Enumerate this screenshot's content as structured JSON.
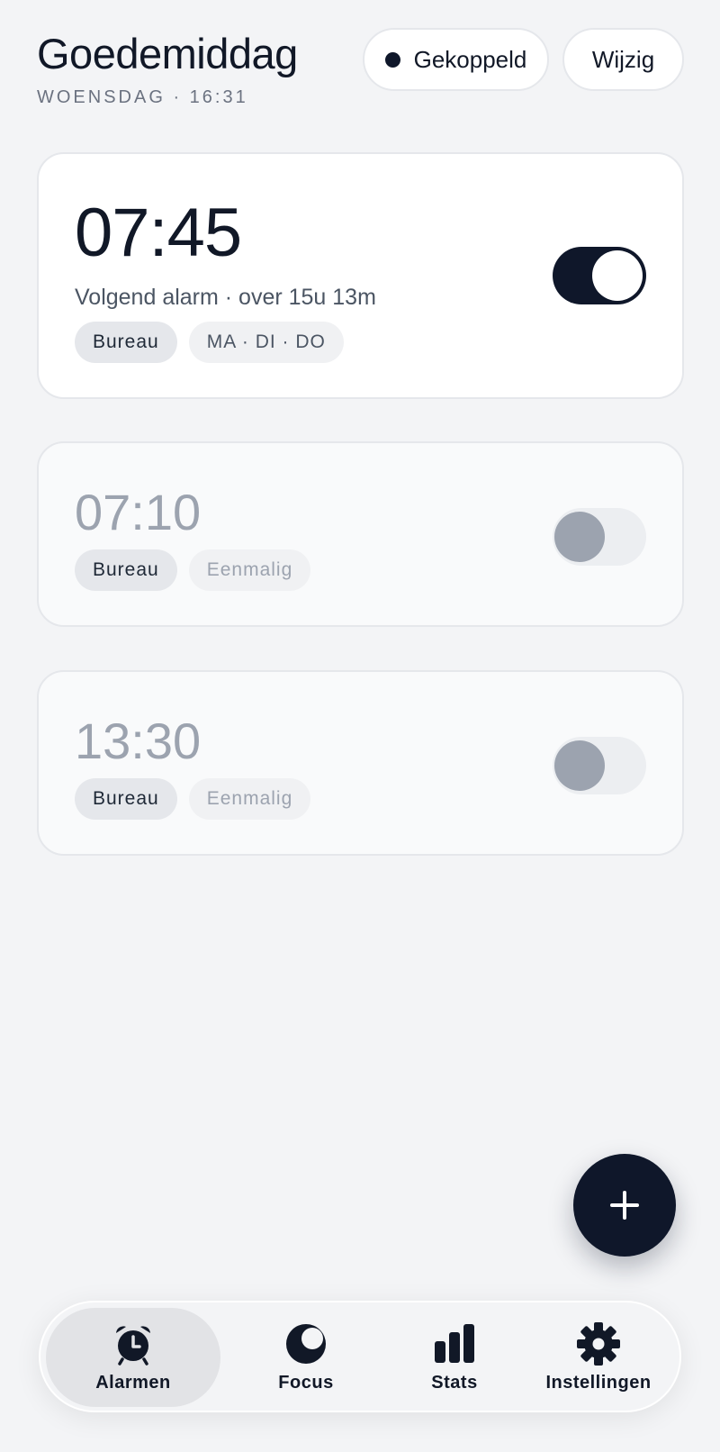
{
  "header": {
    "greeting": "Goedemiddag",
    "dateline": "WOENSDAG · 16:31",
    "status_label": "Gekoppeld",
    "edit_label": "Wijzig"
  },
  "alarms": [
    {
      "time": "07:45",
      "enabled": true,
      "next_text": "Volgend alarm · over 15u 13m",
      "tags": [
        "Bureau",
        "MA · DI · DO"
      ]
    },
    {
      "time": "07:10",
      "enabled": false,
      "tags": [
        "Bureau",
        "Eenmalig"
      ]
    },
    {
      "time": "13:30",
      "enabled": false,
      "tags": [
        "Bureau",
        "Eenmalig"
      ]
    }
  ],
  "fab": {
    "icon": "plus-icon"
  },
  "nav": {
    "items": [
      {
        "label": "Alarmen",
        "icon": "alarm-clock-icon",
        "active": true
      },
      {
        "label": "Focus",
        "icon": "moon-icon",
        "active": false
      },
      {
        "label": "Stats",
        "icon": "bar-chart-icon",
        "active": false
      },
      {
        "label": "Instellingen",
        "icon": "gear-icon",
        "active": false
      }
    ]
  },
  "colors": {
    "background": "#f3f4f6",
    "accent": "#0f172a",
    "muted_text": "#9ca3af"
  }
}
